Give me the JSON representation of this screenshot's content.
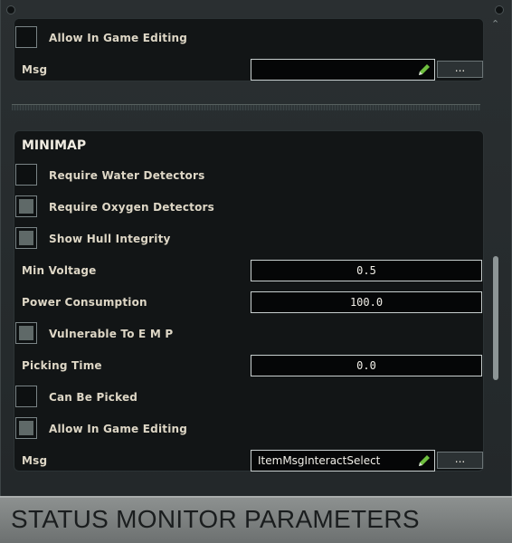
{
  "top_panel": {
    "allow_edit": {
      "label": "Allow In Game Editing",
      "checked": false
    },
    "msg": {
      "label": "Msg",
      "value": "",
      "browse_label": "..."
    }
  },
  "minimap": {
    "title": "MINIMAP",
    "require_water": {
      "label": "Require Water Detectors",
      "checked": false
    },
    "require_oxygen": {
      "label": "Require Oxygen Detectors",
      "checked": true
    },
    "show_hull": {
      "label": "Show Hull Integrity",
      "checked": true
    },
    "min_voltage": {
      "label": "Min Voltage",
      "value": "0.5"
    },
    "power_consumption": {
      "label": "Power Consumption",
      "value": "100.0"
    },
    "vulnerable_emp": {
      "label": "Vulnerable To E M P",
      "checked": true
    },
    "picking_time": {
      "label": "Picking Time",
      "value": "0.0"
    },
    "can_be_picked": {
      "label": "Can Be Picked",
      "checked": false
    },
    "allow_edit": {
      "label": "Allow In Game Editing",
      "checked": true
    },
    "msg": {
      "label": "Msg",
      "value": "ItemMsgInteractSelect",
      "browse_label": "..."
    }
  },
  "footer": {
    "title": "STATUS MONITOR PARAMETERS"
  },
  "icons": {
    "edit": "pencil-icon",
    "scroll": "chevron-up-icon"
  },
  "colors": {
    "accent_edit": "#6fbf3f",
    "panel_bg": "#121516",
    "footer_bg": "#7d8180"
  }
}
